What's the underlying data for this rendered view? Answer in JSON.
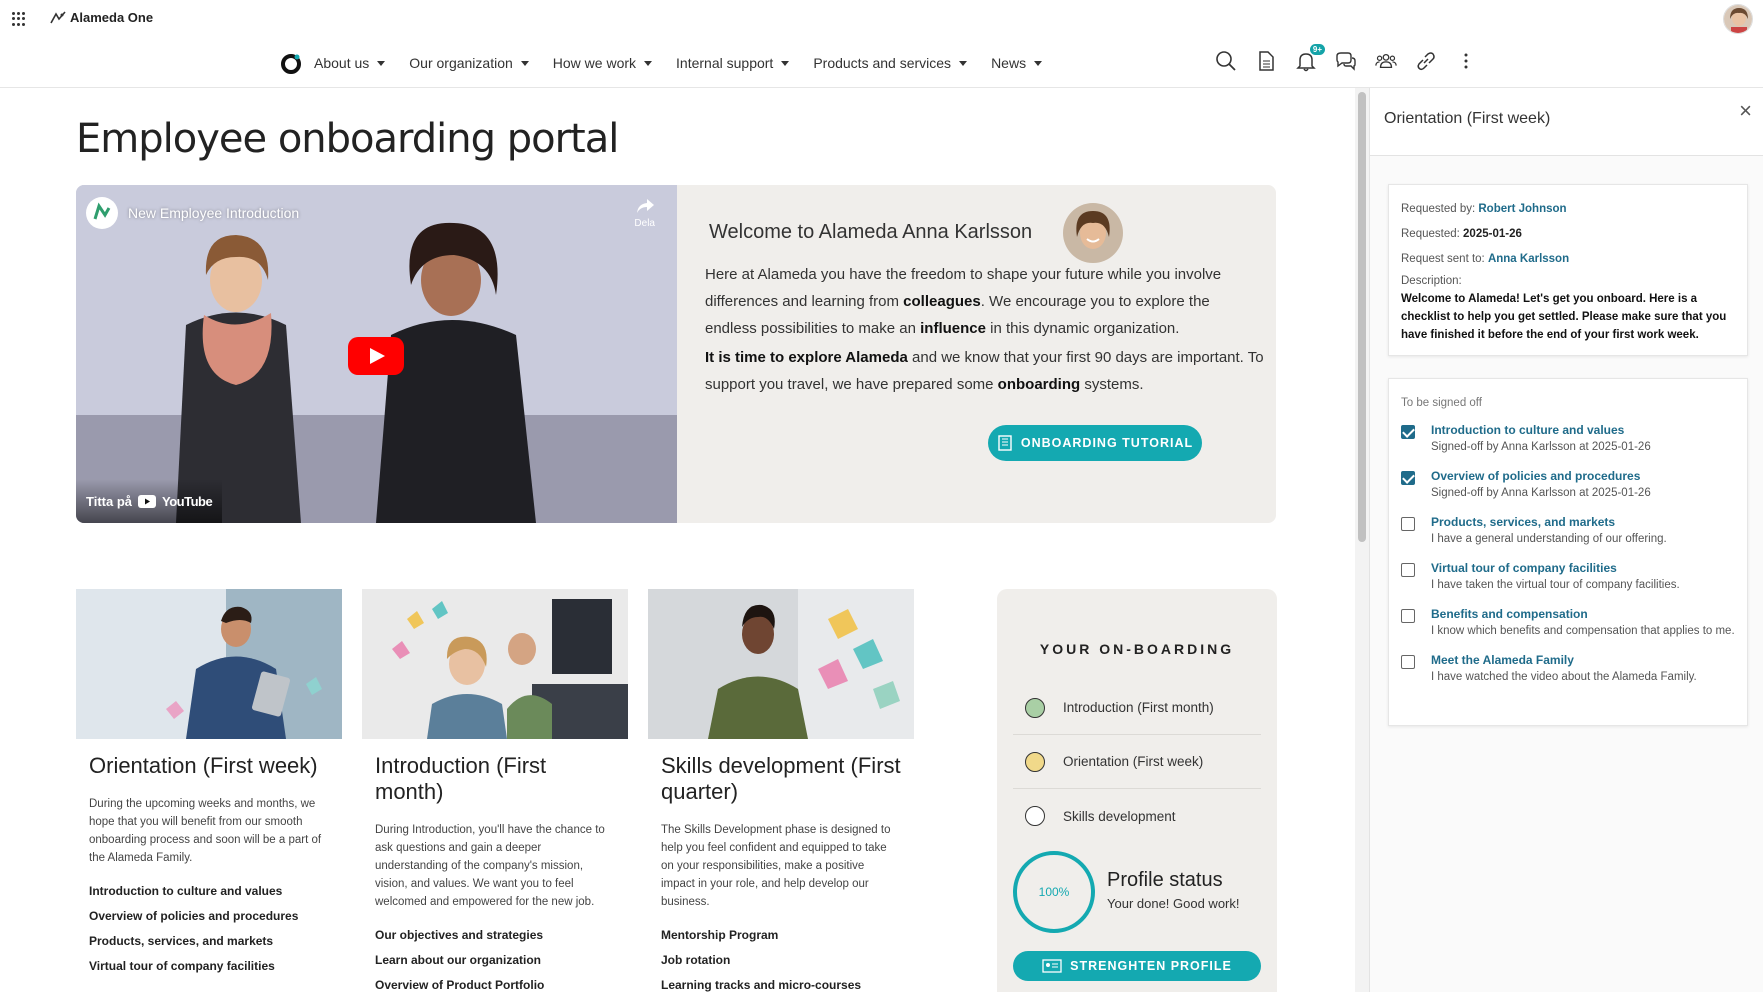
{
  "app": {
    "brand": "Alameda One"
  },
  "nav": {
    "items": [
      {
        "label": "About us"
      },
      {
        "label": "Our organization"
      },
      {
        "label": "How we work"
      },
      {
        "label": "Internal support"
      },
      {
        "label": "Products and services"
      },
      {
        "label": "News"
      }
    ],
    "notification_badge": "9+"
  },
  "page": {
    "title": "Employee onboarding portal"
  },
  "video": {
    "title": "New Employee Introduction",
    "share_label": "Dela",
    "watch_on": "Titta på",
    "platform": "YouTube"
  },
  "welcome": {
    "heading": "Welcome to Alameda Anna Karlsson",
    "p1_a": "Here at Alameda you have the freedom to shape your future while you involve differences and learning from ",
    "p1_b": "colleagues",
    "p1_c": ". We encourage you to explore the endless possibilities to make an ",
    "p1_d": "influence",
    "p1_e": " in this dynamic organization.",
    "p2_a": "It is time to explore Alameda",
    "p2_b": " and we know that your first 90 days are important. To support you travel, we have prepared some ",
    "p2_c": "onboarding",
    "p2_d": " systems.",
    "button": "ONBOARDING TUTORIAL"
  },
  "cards": [
    {
      "title": "Orientation (First week)",
      "desc": "During the upcoming weeks and months, we hope that you will benefit from our smooth onboarding process and soon will be a part of the Alameda Family.",
      "links": [
        "Introduction to culture and values",
        "Overview of policies and procedures",
        "Products, services, and markets",
        "Virtual tour of company facilities"
      ]
    },
    {
      "title": "Introduction (First month)",
      "desc": "During Introduction, you'll have the chance to ask questions and gain a deeper understanding of the company's mission, vision, and values. We want you to feel welcomed and empowered for the new job.",
      "links": [
        "Our objectives and strategies",
        "Learn about our organization",
        "Overview of Product Portfolio"
      ]
    },
    {
      "title": "Skills development (First quarter)",
      "desc": "The Skills Development phase is designed to help you feel confident and equipped to take on your responsibilities, make a positive impact in your role, and help develop our business.",
      "links": [
        "Mentorship Program",
        "Job rotation",
        "Learning tracks and micro-courses"
      ]
    }
  ],
  "onboarding": {
    "title": "YOUR ON-BOARDING",
    "steps": [
      {
        "label": "Introduction (First month)",
        "color": "#a9cfa5"
      },
      {
        "label": "Orientation (First week)",
        "color": "#f1d98a"
      },
      {
        "label": "Skills development",
        "color": "#ffffff"
      }
    ],
    "progress": "100%",
    "status_title": "Profile status",
    "status_text": "Your done! Good work!",
    "button": "STRENGHTEN PROFILE"
  },
  "panel": {
    "title": "Orientation (First week)",
    "requested_by_label": "Requested by:",
    "requested_by": "Robert Johnson",
    "requested_label": "Requested:",
    "requested": "2025-01-26",
    "sent_to_label": "Request sent to:",
    "sent_to": "Anna Karlsson",
    "description_label": "Description:",
    "description": "Welcome to Alameda! Let's get you onboard. Here is a checklist to help you get settled. Please make sure that you have finished it before the end of your first work week.",
    "signoff_label": "To be signed off",
    "tasks": [
      {
        "title": "Introduction to culture and values",
        "sub": "Signed-off by Anna Karlsson at 2025-01-26",
        "checked": true
      },
      {
        "title": "Overview of policies and procedures",
        "sub": "Signed-off by Anna Karlsson at 2025-01-26",
        "checked": true
      },
      {
        "title": "Products, services, and markets",
        "sub": "I have a general understanding of our offering.",
        "checked": false
      },
      {
        "title": "Virtual tour of company facilities",
        "sub": "I have taken the virtual tour of company facilities.",
        "checked": false
      },
      {
        "title": "Benefits and compensation",
        "sub": "I know which benefits and compensation that applies to me.",
        "checked": false
      },
      {
        "title": "Meet the Alameda Family",
        "sub": "I have watched the video about the Alameda Family.",
        "checked": false
      }
    ]
  }
}
